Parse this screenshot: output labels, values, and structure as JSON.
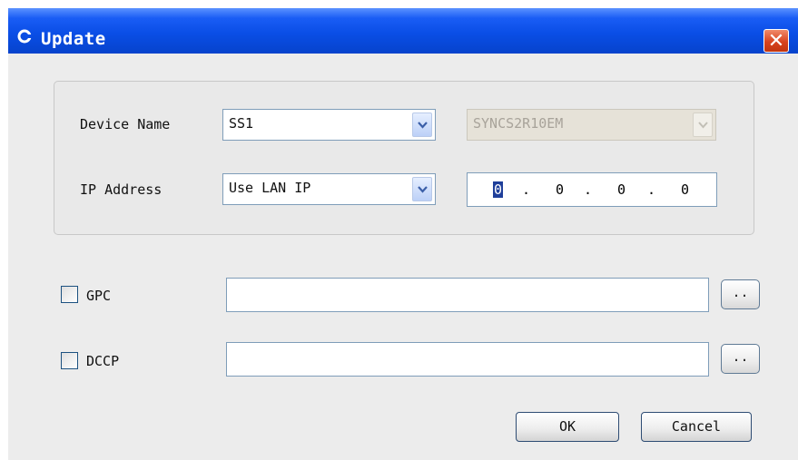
{
  "window": {
    "title": "Update",
    "close_symbol": "✕",
    "colors": {
      "titlebar": "#0a4ee6",
      "close": "#d8431f",
      "background": "#ececec"
    }
  },
  "device": {
    "label": "Device Name",
    "name_value": "SS1",
    "type_value": "SYNCS2R10EM",
    "type_disabled": true
  },
  "ip": {
    "label": "IP Address",
    "mode_value": "Use LAN IP",
    "octets": [
      "0",
      "0",
      "0",
      "0"
    ],
    "separator": "."
  },
  "gpc": {
    "label": "GPC",
    "checked": false,
    "value": "",
    "browse_label": ".."
  },
  "dccp": {
    "label": "DCCP",
    "checked": false,
    "value": "",
    "browse_label": ".."
  },
  "buttons": {
    "ok": "OK",
    "cancel": "Cancel"
  },
  "icons": {
    "window": "app-icon",
    "dropdown": "chevron-down-icon"
  }
}
